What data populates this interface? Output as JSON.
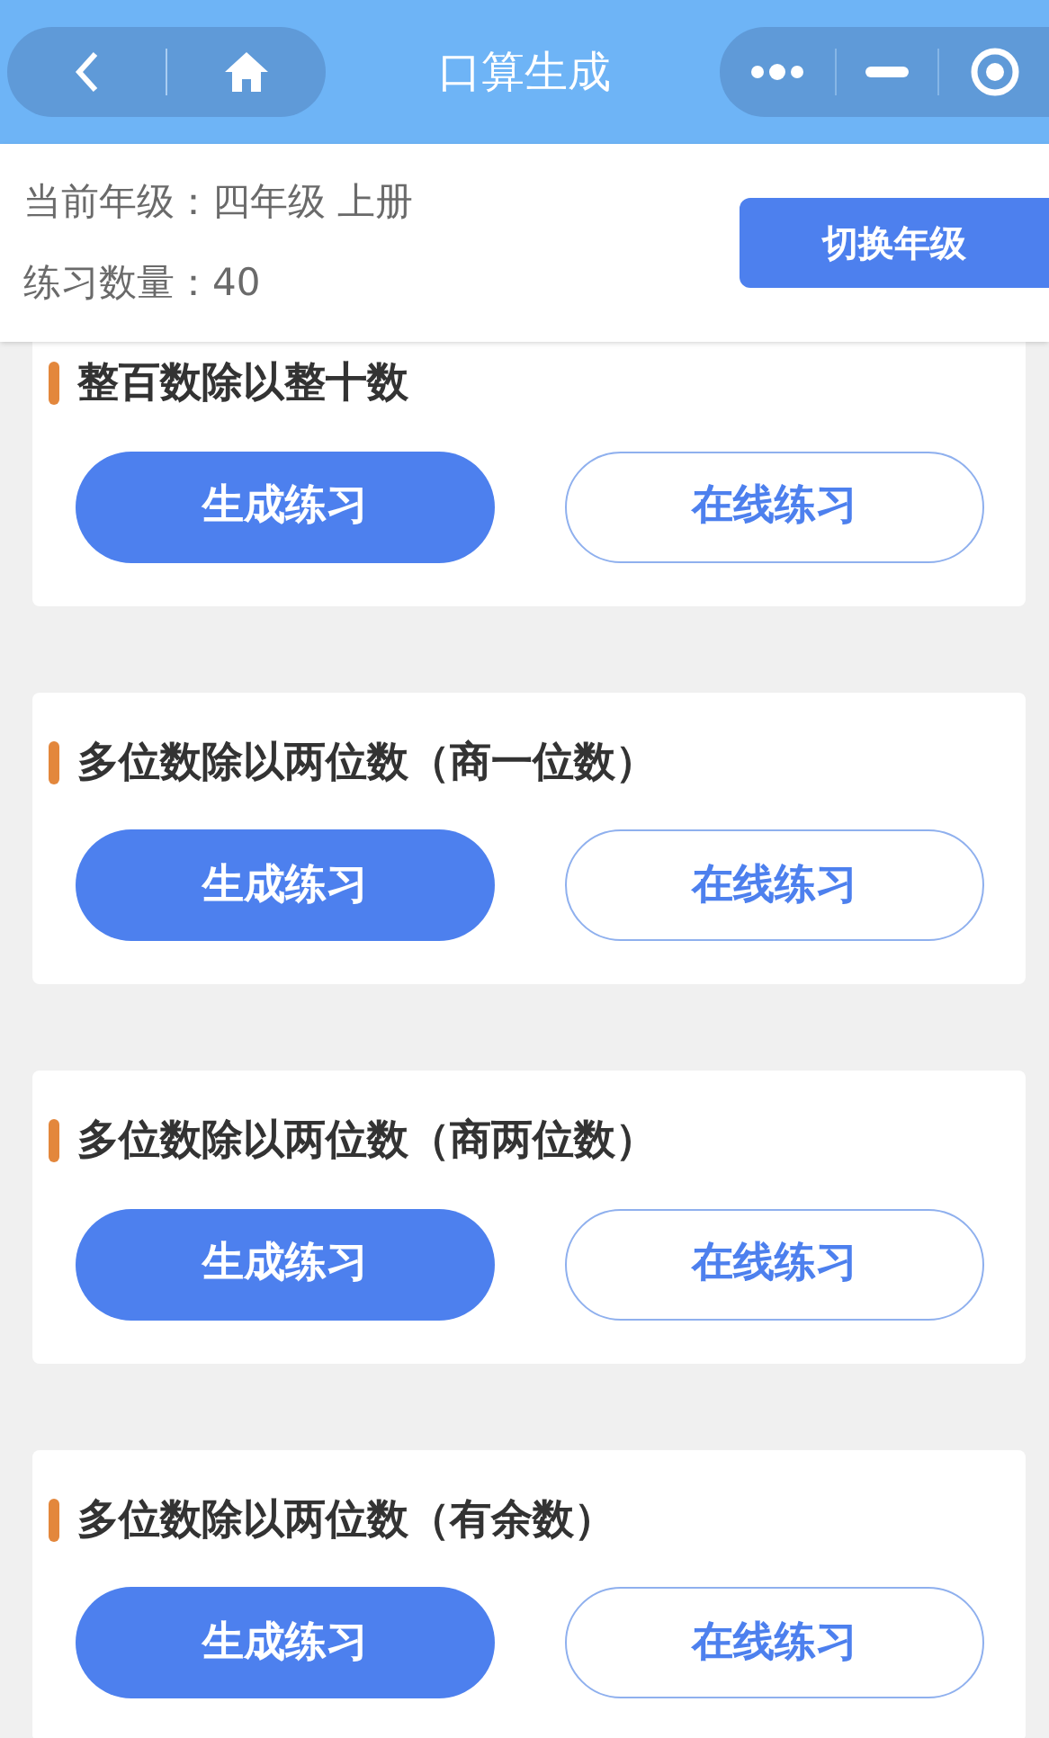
{
  "nav_bar": {
    "title": "口算生成"
  },
  "info": {
    "grade_label": "当前年级：",
    "grade": "四年级 上册",
    "count_label": "练习数量：",
    "count": "40",
    "switch_button": "切换年级"
  },
  "cards": [
    {
      "title": "整百数除以整十数",
      "generate_button": "生成练习",
      "online_button": "在线练习"
    },
    {
      "title": "多位数除以两位数（商一位数）",
      "generate_button": "生成练习",
      "online_button": "在线练习"
    },
    {
      "title": "多位数除以两位数（商两位数）",
      "generate_button": "生成练习",
      "online_button": "在线练习"
    },
    {
      "title": "多位数除以两位数（有余数）",
      "generate_button": "生成练习",
      "online_button": "在线练习"
    }
  ]
}
